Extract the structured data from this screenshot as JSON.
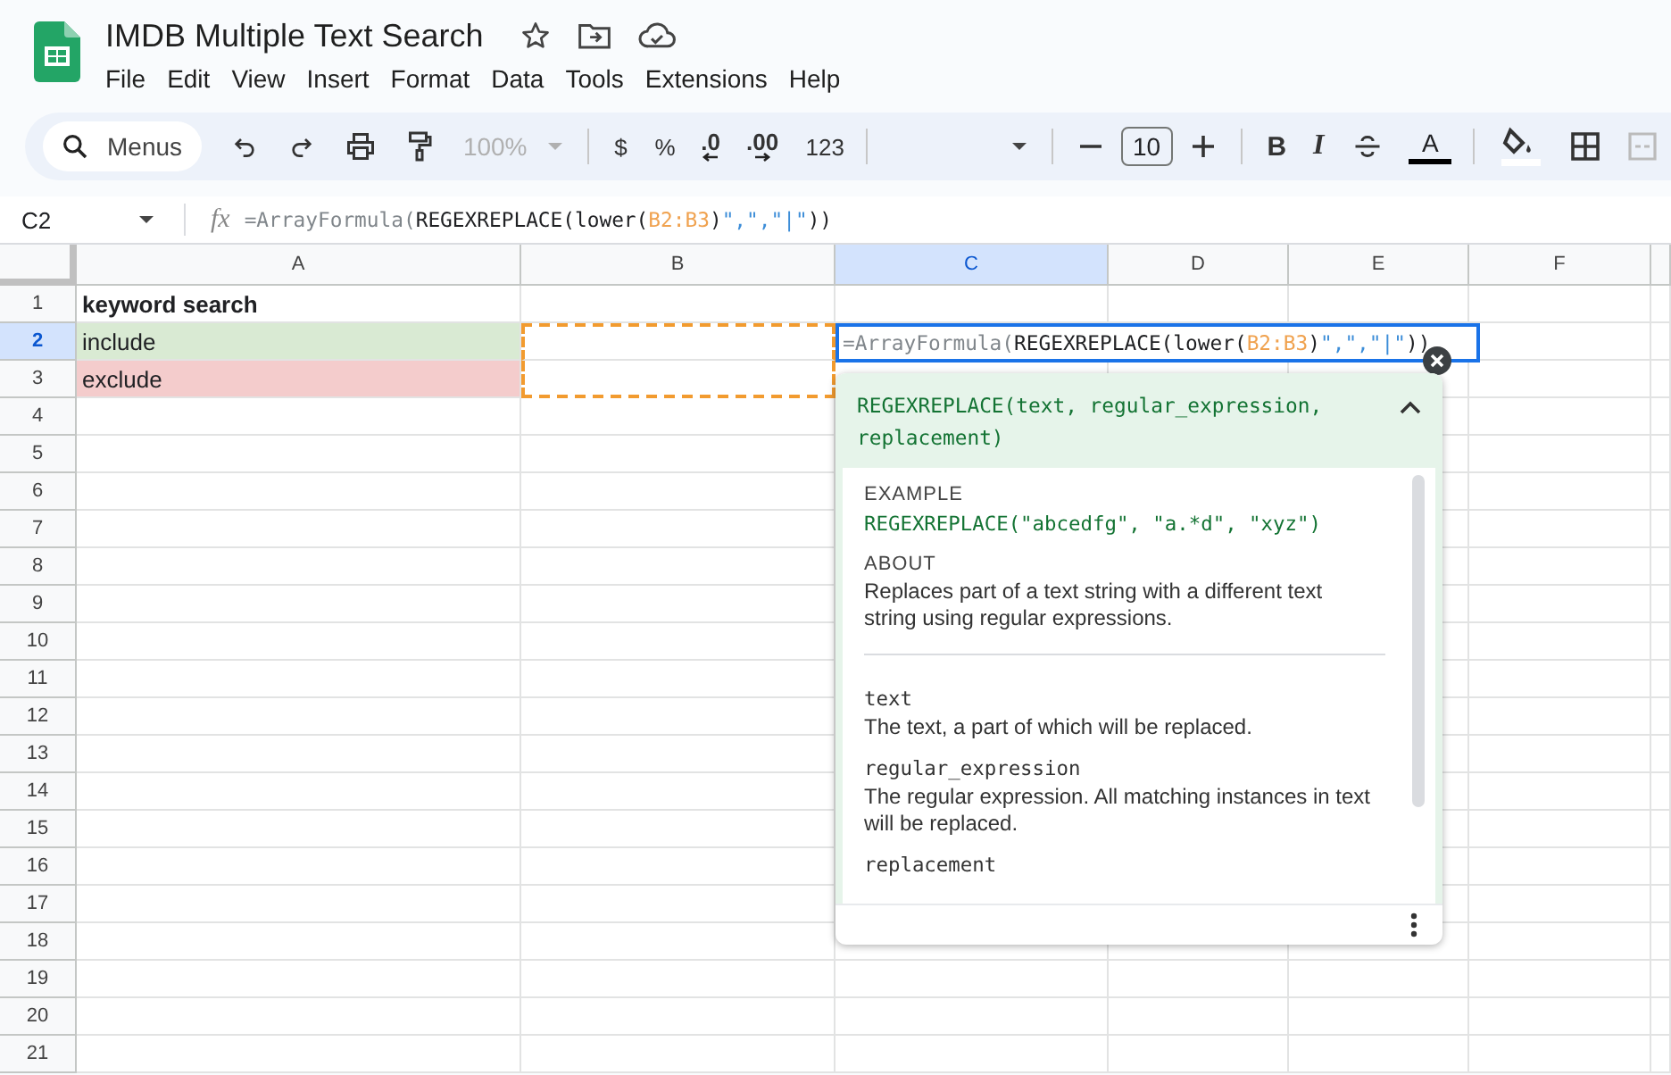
{
  "title": "IMDB Multiple Text Search",
  "menus": [
    "File",
    "Edit",
    "View",
    "Insert",
    "Format",
    "Data",
    "Tools",
    "Extensions",
    "Help"
  ],
  "toolbar": {
    "search": {
      "placeholder": "Menus"
    },
    "items": [
      {
        "kind": "undo"
      },
      {
        "kind": "redo"
      },
      {
        "kind": "print"
      },
      {
        "kind": "paint-format"
      },
      {
        "kind": "select",
        "label": "100%",
        "disabled": true
      },
      {
        "kind": "divider"
      },
      {
        "kind": "text",
        "label": "$"
      },
      {
        "kind": "text",
        "label": "%"
      },
      {
        "kind": "decimal-less",
        "label": ".0"
      },
      {
        "kind": "decimal-more",
        "label": ".00"
      },
      {
        "kind": "text",
        "label": "123"
      },
      {
        "kind": "divider"
      },
      {
        "kind": "font"
      },
      {
        "kind": "divider"
      },
      {
        "kind": "minus"
      },
      {
        "kind": "font-size",
        "label": "10"
      },
      {
        "kind": "plus"
      },
      {
        "kind": "divider"
      },
      {
        "kind": "bold",
        "label": "B"
      },
      {
        "kind": "italic",
        "label": "I"
      },
      {
        "kind": "strike"
      },
      {
        "kind": "text-color",
        "label": "A",
        "color": "#000000"
      },
      {
        "kind": "divider"
      },
      {
        "kind": "fill-color",
        "color": "#ffffff"
      },
      {
        "kind": "borders"
      },
      {
        "kind": "merge"
      }
    ]
  },
  "name_box": "C2",
  "formula_icon": "fx",
  "formula": [
    {
      "kind": "muted",
      "text": "=ArrayFormula("
    },
    {
      "kind": "plain",
      "text": "REGEXREPLACE(lower("
    },
    {
      "kind": "range",
      "text": "B2:B3"
    },
    {
      "kind": "plain",
      "text": ")"
    },
    {
      "kind": "string",
      "text": "\",\",\"|\""
    },
    {
      "kind": "plain",
      "text": "))"
    }
  ],
  "columns": [
    {
      "label": "A",
      "selected": false
    },
    {
      "label": "B",
      "selected": false
    },
    {
      "label": "C",
      "selected": true
    },
    {
      "label": "D",
      "selected": false
    },
    {
      "label": "E",
      "selected": false
    },
    {
      "label": "F",
      "selected": false
    }
  ],
  "rows": [
    {
      "label": "1",
      "selected": false,
      "cells": [
        {
          "text": "keyword search",
          "bold": true
        },
        {
          "copied": false
        },
        {},
        {},
        {},
        {}
      ]
    },
    {
      "label": "2",
      "selected": true,
      "cells": [
        {
          "text": "include",
          "bold": false,
          "color": "#d9ead3"
        },
        {
          "copied": true
        },
        {},
        {},
        {},
        {}
      ]
    },
    {
      "label": "3",
      "selected": false,
      "cells": [
        {
          "text": "exclude",
          "bold": false,
          "color": "#f4cccc"
        },
        {
          "copied": true
        },
        {},
        {},
        {},
        {}
      ]
    },
    {
      "label": "4",
      "selected": false
    },
    {
      "label": "5",
      "selected": false
    },
    {
      "label": "6",
      "selected": false
    },
    {
      "label": "7",
      "selected": false
    },
    {
      "label": "8",
      "selected": false
    },
    {
      "label": "9",
      "selected": false
    },
    {
      "label": "10",
      "selected": false
    },
    {
      "label": "11",
      "selected": false
    },
    {
      "label": "12",
      "selected": false
    },
    {
      "label": "13",
      "selected": false
    },
    {
      "label": "14",
      "selected": false
    },
    {
      "label": "15",
      "selected": false
    },
    {
      "label": "16",
      "selected": false
    },
    {
      "label": "17",
      "selected": false
    },
    {
      "label": "18",
      "selected": false
    },
    {
      "label": "19",
      "selected": false
    },
    {
      "label": "20",
      "selected": false
    },
    {
      "label": "21",
      "selected": false
    }
  ],
  "editor": {
    "formula": [
      {
        "kind": "muted",
        "text": "=ArrayFormula("
      },
      {
        "kind": "plain",
        "text": "REGEXREPLACE(lower("
      },
      {
        "kind": "range",
        "text": "B2:B3"
      },
      {
        "kind": "plain",
        "text": ")"
      },
      {
        "kind": "string",
        "text": "\",\",\"|\""
      },
      {
        "kind": "plain",
        "text": "))"
      }
    ]
  },
  "help": {
    "signature": "REGEXREPLACE(text, regular_expression, replacement)",
    "expanded": true,
    "example_label": "EXAMPLE",
    "example": "REGEXREPLACE(\"abcedfg\", \"a.*d\", \"xyz\")",
    "about_label": "ABOUT",
    "about": "Replaces part of a text string with a different text string using regular expressions.",
    "params": [
      {
        "name": "text",
        "description": "The text, a part of which will be replaced."
      },
      {
        "name": "regular_expression",
        "description": "The regular expression. All matching instances in text will be replaced."
      },
      {
        "name": "replacement"
      }
    ]
  }
}
